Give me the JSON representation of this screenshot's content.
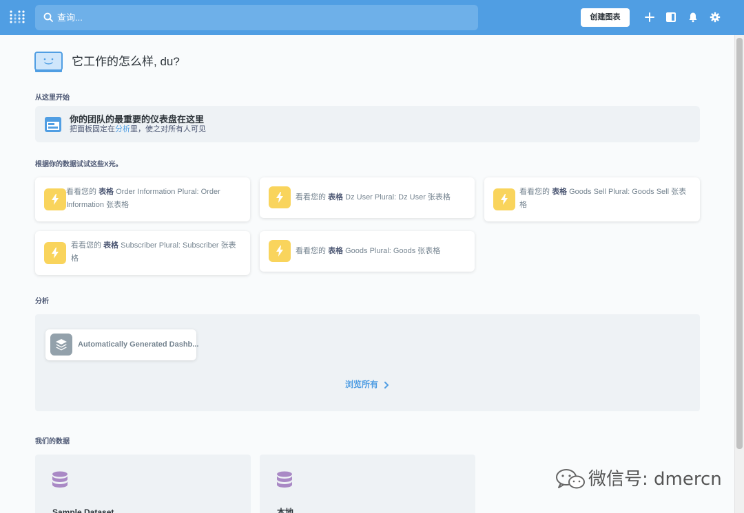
{
  "topbar": {
    "search_placeholder": "查询...",
    "create_label": "创建图表",
    "icons": [
      "metabase-logo-icon",
      "search-icon",
      "plus-icon",
      "dashboard-icon",
      "bell-icon",
      "gear-icon"
    ],
    "color": "#509ee3"
  },
  "greeting": "它工作的怎么样, du?",
  "start_here": {
    "label": "从这里开始",
    "title": "你的团队的最重要的仪表盘在这里",
    "sub_prefix": "把面板固定在",
    "sub_link": "分析",
    "sub_suffix": "里，使之对所有人可见"
  },
  "xrays": {
    "label": "根据你的数据试试这些X光。",
    "items": [
      {
        "prefix": "看看您的",
        "kind": "表格",
        "text1": "Order Information Plural: Order",
        "text2": "Information 张表格"
      },
      {
        "prefix": "看看您的",
        "kind": "表格",
        "text1": "Dz User Plural: Dz User 张表格",
        "text2": ""
      },
      {
        "prefix": "看看您的",
        "kind": "表格",
        "text1": "Goods Sell Plural: Goods Sell 张表",
        "text2": "格"
      },
      {
        "prefix": "看看您的",
        "kind": "表格",
        "text1": "Subscriber Plural: Subscriber 张表",
        "text2": "格"
      },
      {
        "prefix": "看看您的",
        "kind": "表格",
        "text1": "Goods Plural: Goods 张表格",
        "text2": ""
      }
    ]
  },
  "analytics": {
    "label": "分析",
    "dashboard_title": "Automatically Generated Dashb...",
    "browse_all": "浏览所有"
  },
  "our_data": {
    "label": "我们的数据",
    "databases": [
      {
        "name": "Sample Dataset"
      },
      {
        "name": "本地"
      }
    ]
  },
  "watermark": "微信号: dmercn"
}
